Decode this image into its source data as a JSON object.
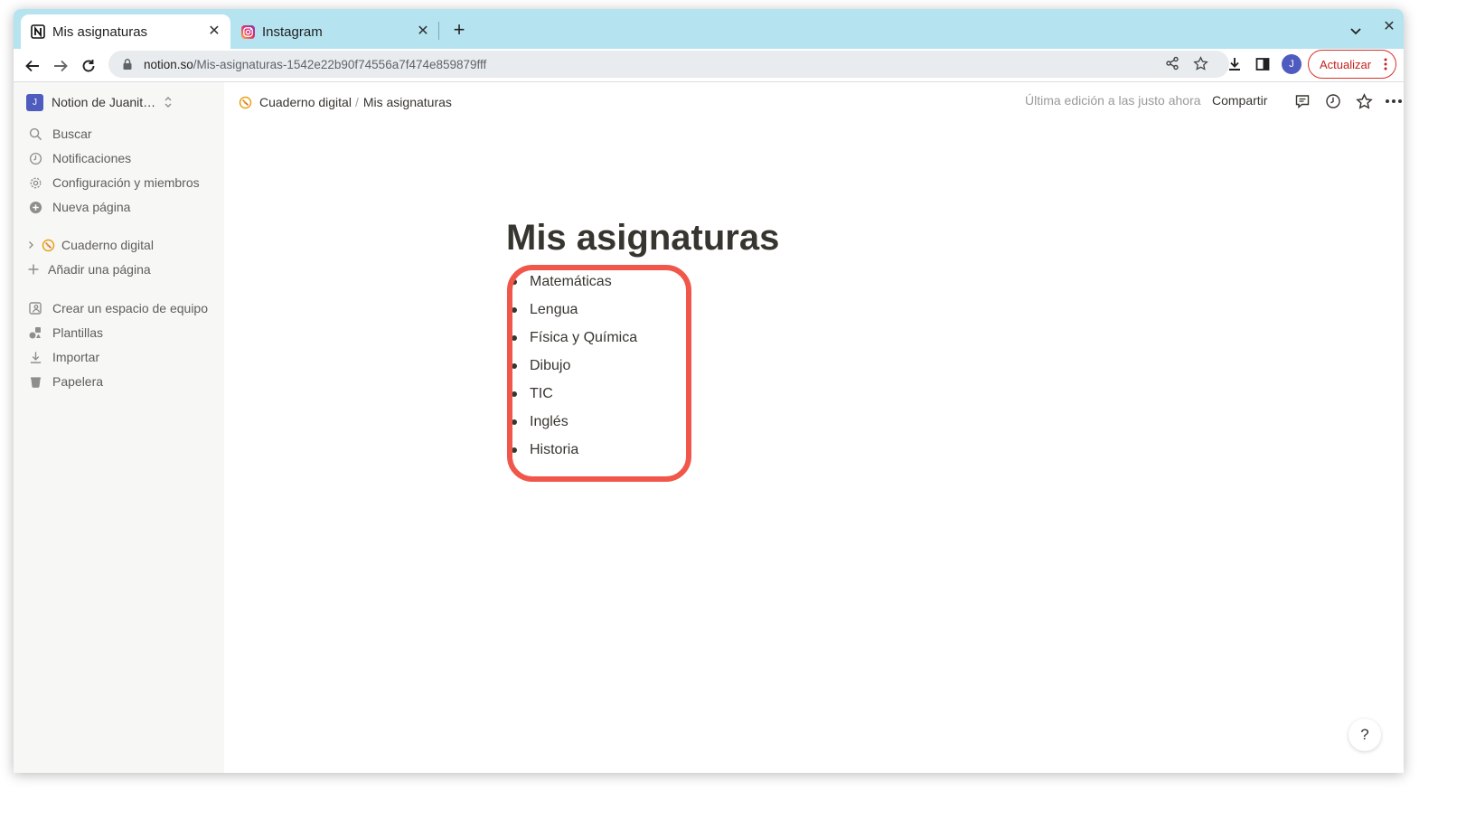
{
  "browser": {
    "tabs": [
      {
        "title": "Mis asignaturas",
        "favicon": "notion-icon",
        "active": true
      },
      {
        "title": "Instagram",
        "favicon": "instagram-icon",
        "active": false
      }
    ],
    "url_host": "notion.so",
    "url_path": "/Mis-asignaturas-1542e22b90f74556a7f474e859879fff",
    "profile_initial": "J",
    "update_label": "Actualizar"
  },
  "sidebar": {
    "workspace_initial": "J",
    "workspace_name": "Notion de Juanit…",
    "menu": [
      {
        "label": "Buscar",
        "icon": "search-icon"
      },
      {
        "label": "Notificaciones",
        "icon": "clock-icon"
      },
      {
        "label": "Configuración y miembros",
        "icon": "gear-icon"
      },
      {
        "label": "Nueva página",
        "icon": "plus-circle-icon"
      }
    ],
    "pages": [
      {
        "label": "Cuaderno digital",
        "icon": "compass-icon"
      }
    ],
    "add_page": "Añadir una página",
    "footer": [
      {
        "label": "Crear un espacio de equipo",
        "icon": "team-icon"
      },
      {
        "label": "Plantillas",
        "icon": "shapes-icon"
      },
      {
        "label": "Importar",
        "icon": "download-icon"
      },
      {
        "label": "Papelera",
        "icon": "trash-icon"
      }
    ]
  },
  "topbar": {
    "breadcrumb": [
      "Cuaderno digital",
      "Mis asignaturas"
    ],
    "last_edited": "Última edición a las justo ahora",
    "share": "Compartir"
  },
  "page": {
    "title": "Mis asignaturas",
    "items": [
      "Matemáticas",
      "Lengua",
      "Física y Química",
      "Dibujo",
      "TIC",
      "Inglés",
      "Historia"
    ],
    "highlight_color": "#f0574a"
  },
  "help_label": "?"
}
